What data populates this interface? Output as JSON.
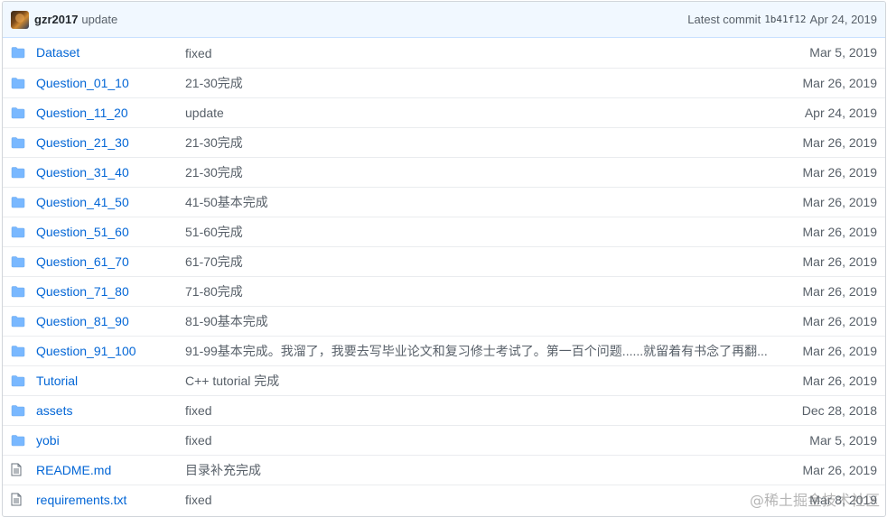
{
  "commit": {
    "author": "gzr2017",
    "message": "update",
    "prefix": "Latest commit",
    "sha": "1b41f12",
    "date": "Apr 24, 2019"
  },
  "files": [
    {
      "type": "folder-icon",
      "name": "Dataset",
      "message": "fixed",
      "date": "Mar 5, 2019"
    },
    {
      "type": "folder-icon",
      "name": "Question_01_10",
      "message": "21-30完成",
      "date": "Mar 26, 2019"
    },
    {
      "type": "folder-icon",
      "name": "Question_11_20",
      "message": "update",
      "date": "Apr 24, 2019"
    },
    {
      "type": "folder-icon",
      "name": "Question_21_30",
      "message": "21-30完成",
      "date": "Mar 26, 2019"
    },
    {
      "type": "folder-icon",
      "name": "Question_31_40",
      "message": "21-30完成",
      "date": "Mar 26, 2019"
    },
    {
      "type": "folder-icon",
      "name": "Question_41_50",
      "message": "41-50基本完成",
      "date": "Mar 26, 2019"
    },
    {
      "type": "folder-icon",
      "name": "Question_51_60",
      "message": "51-60完成",
      "date": "Mar 26, 2019"
    },
    {
      "type": "folder-icon",
      "name": "Question_61_70",
      "message": "61-70完成",
      "date": "Mar 26, 2019"
    },
    {
      "type": "folder-icon",
      "name": "Question_71_80",
      "message": "71-80完成",
      "date": "Mar 26, 2019"
    },
    {
      "type": "folder-icon",
      "name": "Question_81_90",
      "message": "81-90基本完成",
      "date": "Mar 26, 2019"
    },
    {
      "type": "folder-icon",
      "name": "Question_91_100",
      "message": "91-99基本完成。我溜了，我要去写毕业论文和复习修士考试了。第一百个问题......就留着有书念了再翻...",
      "date": "Mar 26, 2019"
    },
    {
      "type": "folder-icon",
      "name": "Tutorial",
      "message": "C++ tutorial 完成",
      "date": "Mar 26, 2019"
    },
    {
      "type": "folder-icon",
      "name": "assets",
      "message": "fixed",
      "date": "Dec 28, 2018"
    },
    {
      "type": "folder-icon",
      "name": "yobi",
      "message": "fixed",
      "date": "Mar 5, 2019"
    },
    {
      "type": "file-icon",
      "name": "README.md",
      "message": "目录补充完成",
      "date": "Mar 26, 2019"
    },
    {
      "type": "file-icon",
      "name": "requirements.txt",
      "message": "fixed",
      "date": "Mar 8, 2019"
    }
  ],
  "watermark": "@稀土掘金技术社区",
  "colors": {
    "link": "#0366d6",
    "folder": "#79b8ff",
    "muted": "#586069",
    "header_bg": "#f1f8ff"
  }
}
